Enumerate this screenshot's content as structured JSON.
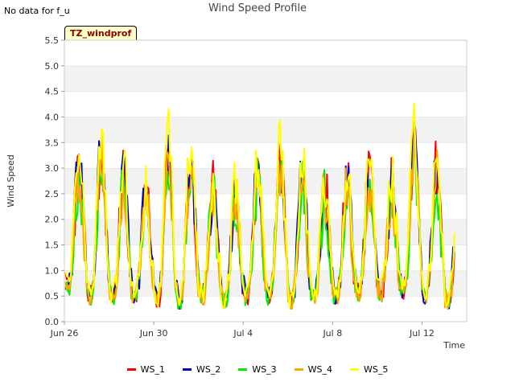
{
  "header": {
    "note": "No data for f_u",
    "title": "Wind Speed Profile"
  },
  "site_tag": "TZ_windprof",
  "chart_data": {
    "type": "line",
    "title": "Wind Speed Profile",
    "xlabel": "Time",
    "ylabel": "Wind Speed",
    "x_ticks": [
      "Jun 26",
      "Jun 30",
      "Jul 4",
      "Jul 8",
      "Jul 12"
    ],
    "x_tick_days": [
      0,
      4,
      8,
      12,
      16
    ],
    "x_range_days": [
      0,
      18
    ],
    "ylim": [
      0,
      5.5
    ],
    "y_ticks": [
      0.0,
      0.5,
      1.0,
      1.5,
      2.0,
      2.5,
      3.0,
      3.5,
      4.0,
      4.5,
      5.0,
      5.5
    ],
    "grid": "horizontal bands",
    "legend_position": "bottom",
    "series": [
      {
        "name": "WS_1",
        "color": "#ff0000",
        "scale": 1.0
      },
      {
        "name": "WS_2",
        "color": "#0000cc",
        "scale": 1.02
      },
      {
        "name": "WS_3",
        "color": "#00ee00",
        "scale": 0.92
      },
      {
        "name": "WS_4",
        "color": "#ffa500",
        "scale": 0.96
      },
      {
        "name": "WS_5",
        "color": "#ffff00",
        "scale": 1.08
      }
    ],
    "daily_peaks": [
      3.0,
      3.3,
      2.8,
      2.4,
      3.3,
      3.2,
      2.6,
      2.5,
      2.9,
      3.2,
      3.0,
      2.6,
      2.7,
      2.9,
      2.6,
      3.4,
      3.0,
      2.6,
      2.3
    ],
    "daily_troughs": [
      0.7,
      0.5,
      0.5,
      0.5,
      0.4,
      0.4,
      0.5,
      0.4,
      0.5,
      0.5,
      0.4,
      0.5,
      0.5,
      0.6,
      0.6,
      0.6,
      0.5,
      0.4,
      0.5
    ]
  }
}
